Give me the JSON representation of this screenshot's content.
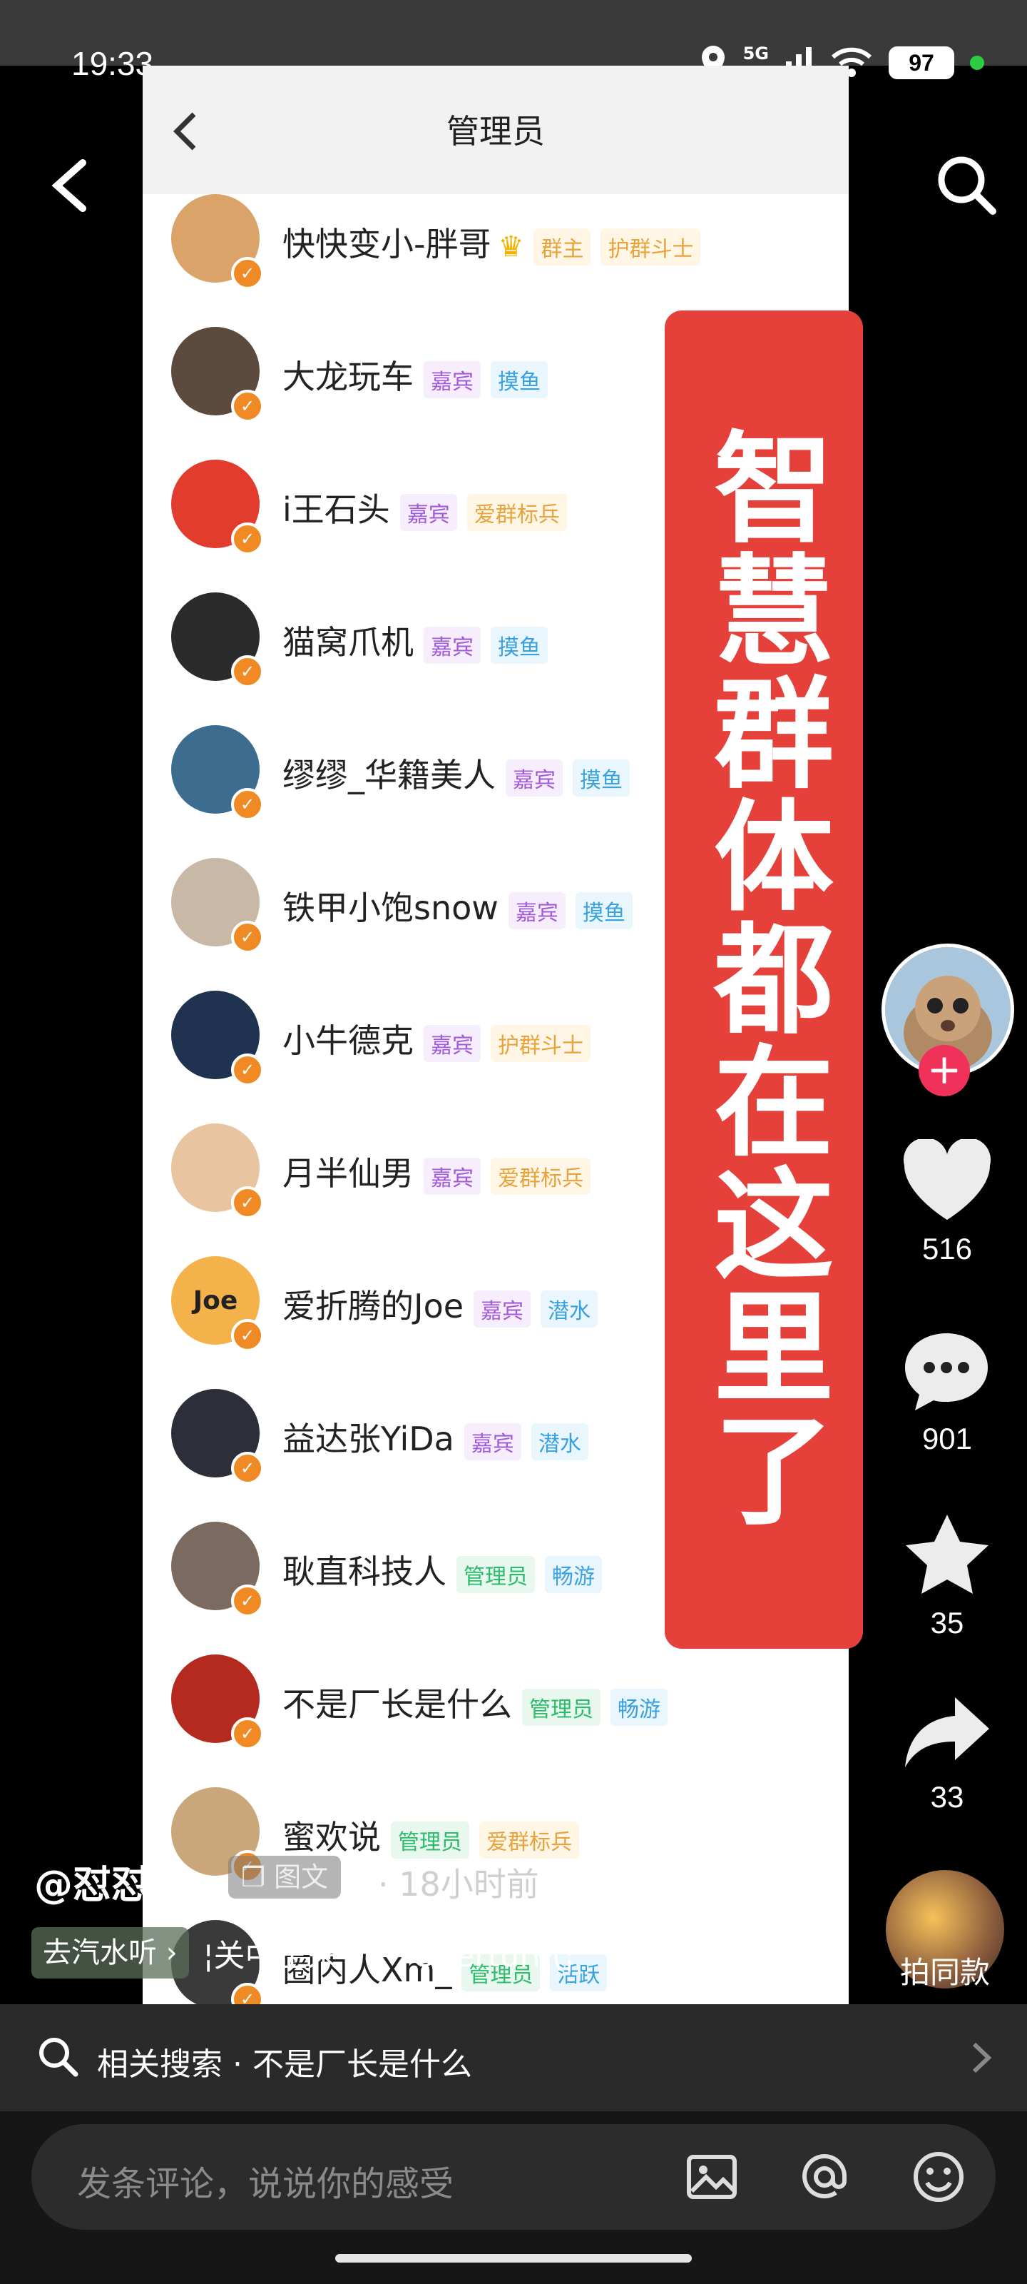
{
  "status_bar": {
    "time": "19:33",
    "network": "5G",
    "battery": "97",
    "colors": {
      "bar": "#3a3a3a",
      "dot": "#2ecc40"
    }
  },
  "screen": {
    "title": "管理员",
    "members": [
      {
        "name": "快快变小-胖哥",
        "tags": [
          "群主",
          "护群斗士"
        ],
        "tag_colors": [
          "orange",
          "orange"
        ],
        "crown": true,
        "avatar_color": "#d9a36a"
      },
      {
        "name": "大龙玩车",
        "tags": [
          "嘉宾",
          "摸鱼"
        ],
        "tag_colors": [
          "purple",
          "blue"
        ],
        "avatar_color": "#5b4a3d"
      },
      {
        "name": "i王石头",
        "tags": [
          "嘉宾",
          "爱群标兵"
        ],
        "tag_colors": [
          "purple",
          "orange"
        ],
        "avatar_color": "#e23c2e"
      },
      {
        "name": "猫窝爪机",
        "tags": [
          "嘉宾",
          "摸鱼"
        ],
        "tag_colors": [
          "purple",
          "blue"
        ],
        "avatar_color": "#2b2b2b"
      },
      {
        "name": "缪缪_华籍美人",
        "tags": [
          "嘉宾",
          "摸鱼"
        ],
        "tag_colors": [
          "purple",
          "blue"
        ],
        "avatar_color": "#3c6d8f"
      },
      {
        "name": "铁甲小饱snow",
        "tags": [
          "嘉宾",
          "摸鱼"
        ],
        "tag_colors": [
          "purple",
          "blue"
        ],
        "avatar_color": "#c7b9a6"
      },
      {
        "name": "小牛德克",
        "tags": [
          "嘉宾",
          "护群斗士"
        ],
        "tag_colors": [
          "purple",
          "orange"
        ],
        "avatar_color": "#1f3350"
      },
      {
        "name": "月半仙男",
        "tags": [
          "嘉宾",
          "爱群标兵"
        ],
        "tag_colors": [
          "purple",
          "orange"
        ],
        "avatar_color": "#e9c4a0"
      },
      {
        "name": "爱折腾的Joe",
        "tags": [
          "嘉宾",
          "潜水"
        ],
        "tag_colors": [
          "purple",
          "blue"
        ],
        "avatar_color": "#f3b24a",
        "avatar_text": "Joe"
      },
      {
        "name": "益达张YiDa",
        "tags": [
          "嘉宾",
          "潜水"
        ],
        "tag_colors": [
          "purple",
          "blue"
        ],
        "avatar_color": "#2c2f3a"
      },
      {
        "name": "耿直科技人",
        "tags": [
          "管理员",
          "畅游"
        ],
        "tag_colors": [
          "green",
          "blue"
        ],
        "avatar_color": "#7a6a60"
      },
      {
        "name": "不是厂长是什么",
        "tags": [
          "管理员",
          "畅游"
        ],
        "tag_colors": [
          "green",
          "blue"
        ],
        "avatar_color": "#b52a1e"
      },
      {
        "name": "蜜欢说",
        "tags": [
          "管理员",
          "爱群标兵"
        ],
        "tag_colors": [
          "green",
          "orange"
        ],
        "avatar_color": "#c9a77a"
      },
      {
        "name": "圈内人Xm_",
        "tags": [
          "管理员",
          "活跃"
        ],
        "tag_colors": [
          "green",
          "blue"
        ],
        "avatar_color": "#3a3a3a"
      }
    ]
  },
  "banner": {
    "text": "智慧群体都在这里了",
    "color": "#e5403a"
  },
  "rail": {
    "likes": "516",
    "comments": "901",
    "favorites": "35",
    "shares": "33",
    "same_style": "拍同款"
  },
  "post": {
    "author": "@怼怼猫",
    "type_chip": "图文",
    "time_ago": "· 18小时前",
    "music_chip": "去汽水听 ›",
    "music_title": "¦关中王来了）  Overturn(¦"
  },
  "related_search": "相关搜索 · 不是厂长是什么",
  "comment": {
    "placeholder": "发条评论，说说你的感受"
  }
}
